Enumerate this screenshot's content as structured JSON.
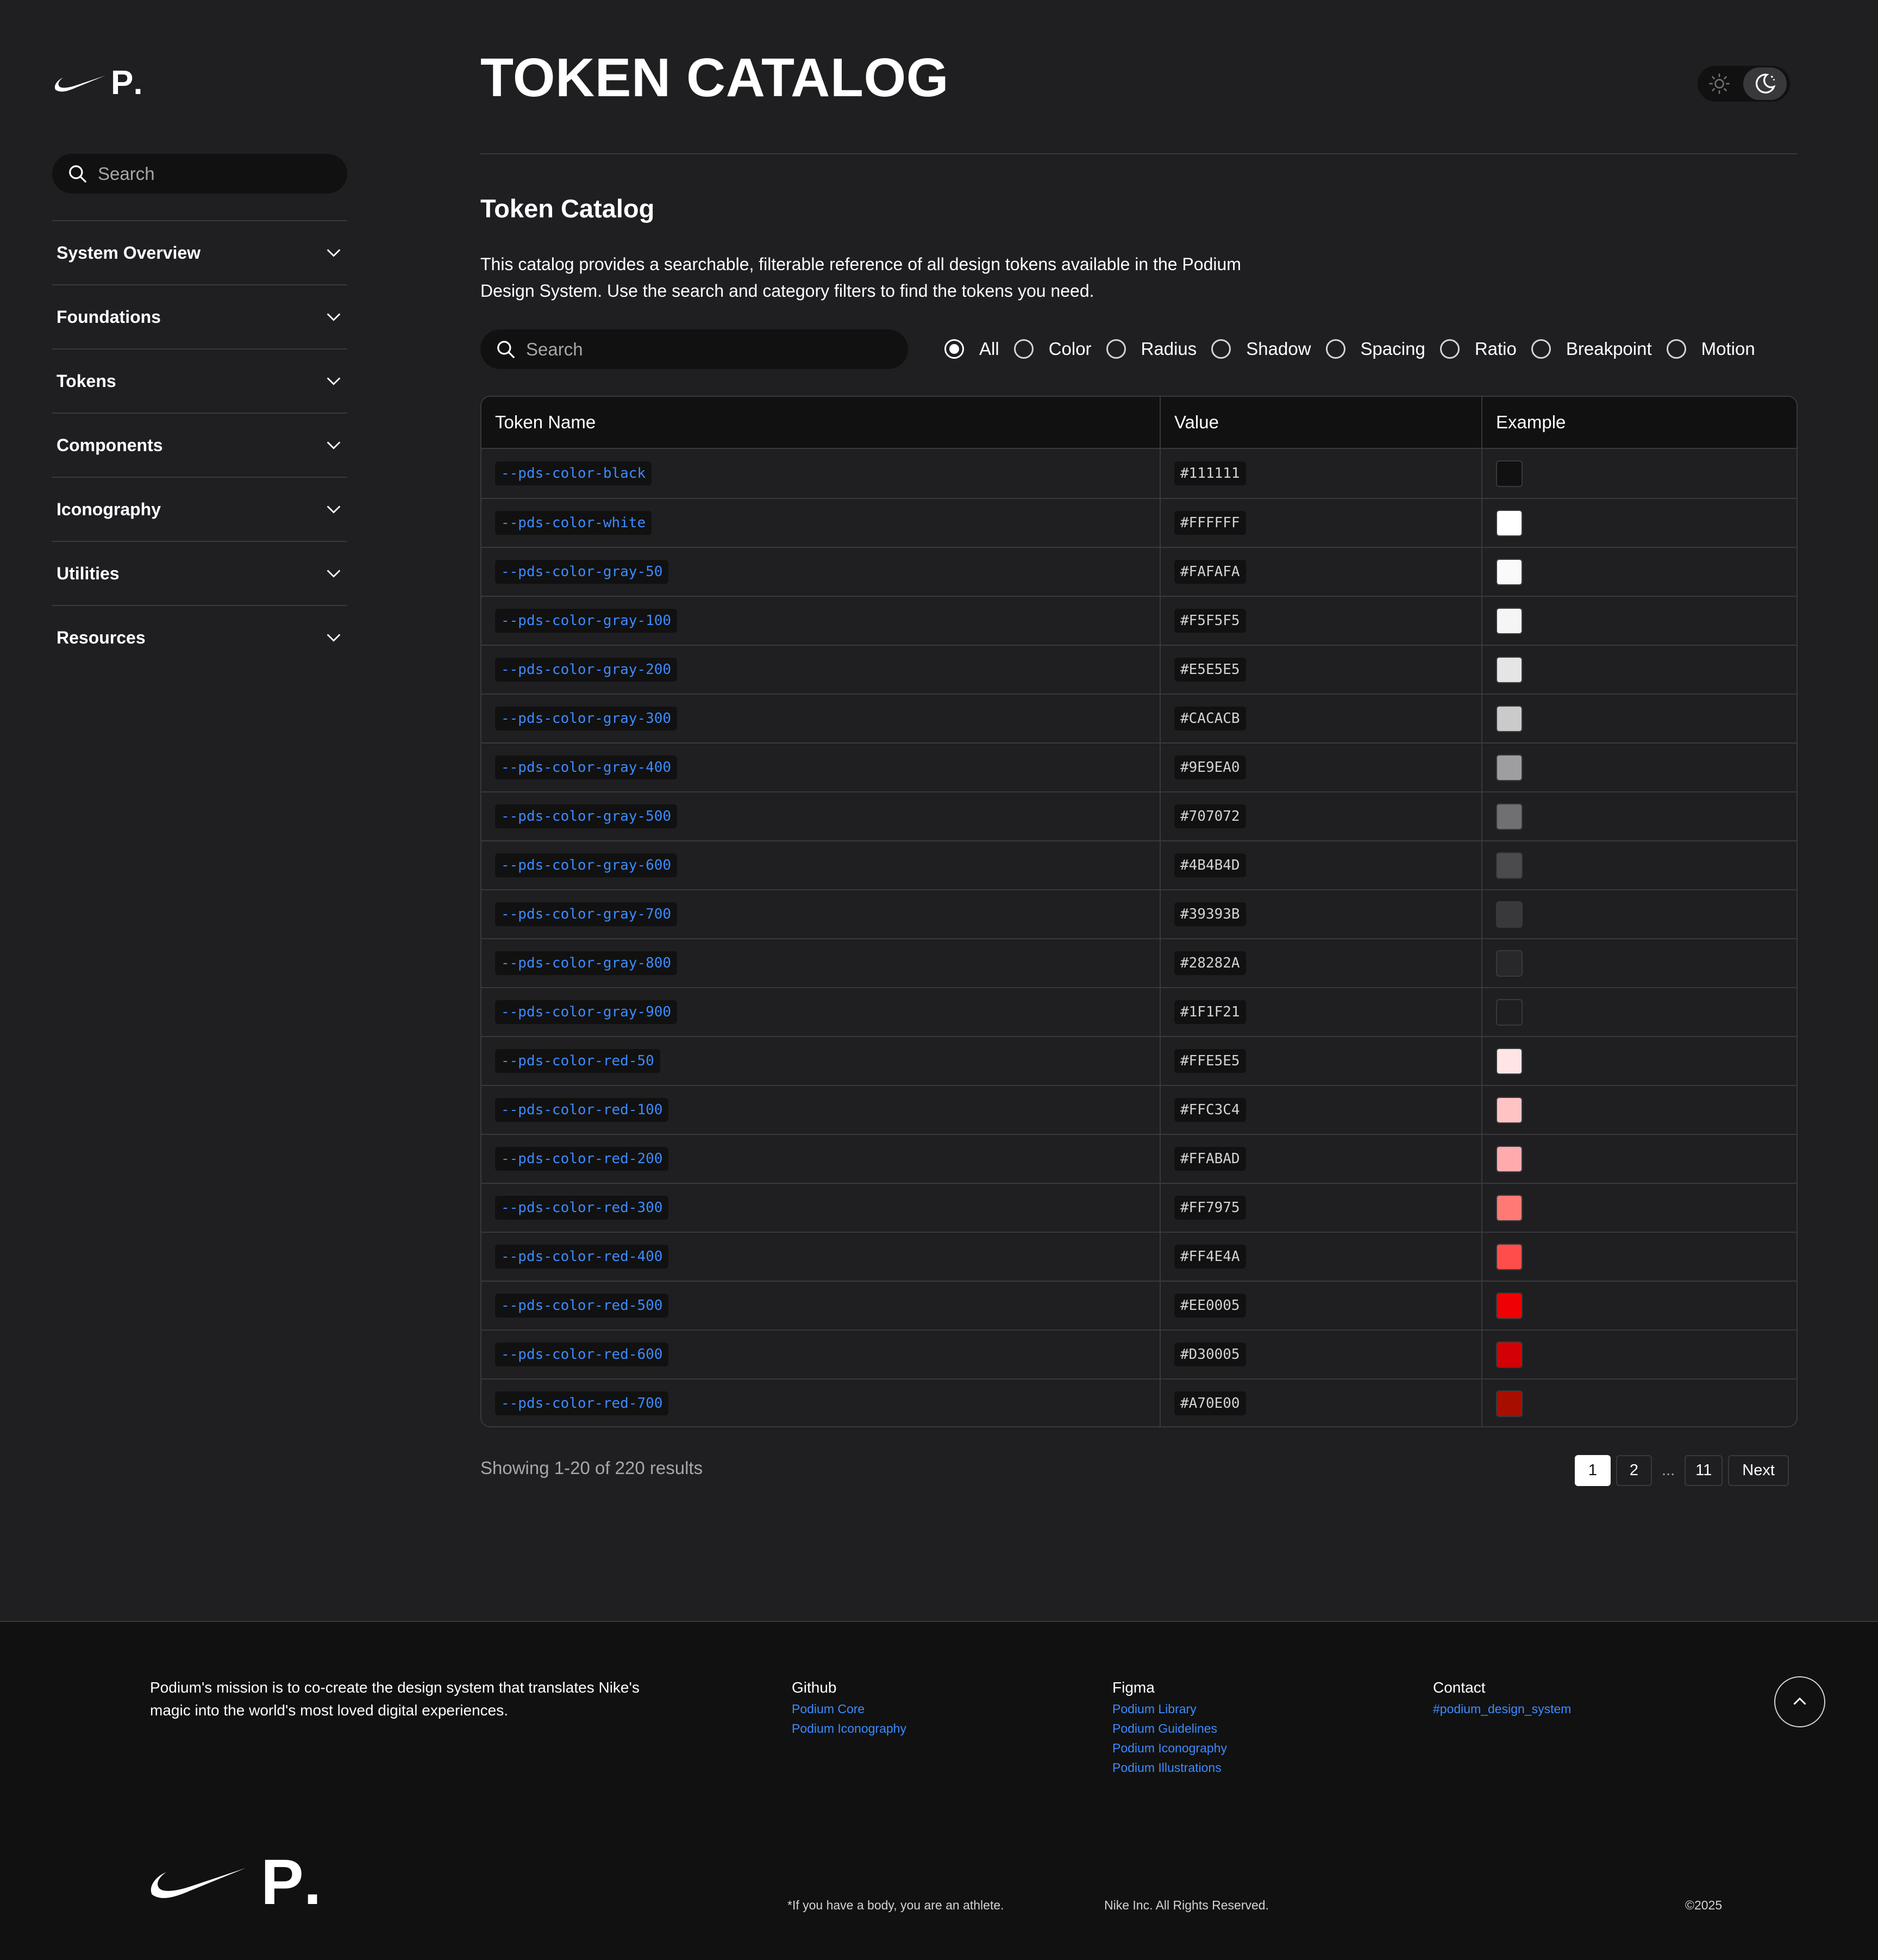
{
  "brand": {
    "logo_letter": "P",
    "logo_dot": "."
  },
  "sidebar": {
    "search_placeholder": "Search",
    "items": [
      {
        "label": "System Overview"
      },
      {
        "label": "Foundations"
      },
      {
        "label": "Tokens"
      },
      {
        "label": "Components"
      },
      {
        "label": "Iconography"
      },
      {
        "label": "Utilities"
      },
      {
        "label": "Resources"
      }
    ]
  },
  "header": {
    "title": "TOKEN CATALOG",
    "theme_toggle": {
      "options": [
        "light",
        "dark"
      ],
      "selected": "dark"
    }
  },
  "main": {
    "section_title": "Token Catalog",
    "intro": "This catalog provides a searchable, filterable reference of all design tokens available in the Podium Design System. Use the search and category filters to find the tokens you need.",
    "search_placeholder": "Search",
    "filters": [
      "All",
      "Color",
      "Radius",
      "Shadow",
      "Spacing",
      "Ratio",
      "Breakpoint",
      "Motion"
    ],
    "selected_filter": "All",
    "table": {
      "columns": [
        "Token Name",
        "Value",
        "Example"
      ],
      "rows": [
        {
          "name": "--pds-color-black",
          "value": "#111111"
        },
        {
          "name": "--pds-color-white",
          "value": "#FFFFFF"
        },
        {
          "name": "--pds-color-gray-50",
          "value": "#FAFAFA"
        },
        {
          "name": "--pds-color-gray-100",
          "value": "#F5F5F5"
        },
        {
          "name": "--pds-color-gray-200",
          "value": "#E5E5E5"
        },
        {
          "name": "--pds-color-gray-300",
          "value": "#CACACB"
        },
        {
          "name": "--pds-color-gray-400",
          "value": "#9E9EA0"
        },
        {
          "name": "--pds-color-gray-500",
          "value": "#707072"
        },
        {
          "name": "--pds-color-gray-600",
          "value": "#4B4B4D"
        },
        {
          "name": "--pds-color-gray-700",
          "value": "#39393B"
        },
        {
          "name": "--pds-color-gray-800",
          "value": "#28282A"
        },
        {
          "name": "--pds-color-gray-900",
          "value": "#1F1F21"
        },
        {
          "name": "--pds-color-red-50",
          "value": "#FFE5E5"
        },
        {
          "name": "--pds-color-red-100",
          "value": "#FFC3C4"
        },
        {
          "name": "--pds-color-red-200",
          "value": "#FFABAD"
        },
        {
          "name": "--pds-color-red-300",
          "value": "#FF7975"
        },
        {
          "name": "--pds-color-red-400",
          "value": "#FF4E4A"
        },
        {
          "name": "--pds-color-red-500",
          "value": "#EE0005"
        },
        {
          "name": "--pds-color-red-600",
          "value": "#D30005"
        },
        {
          "name": "--pds-color-red-700",
          "value": "#A70E00"
        }
      ]
    },
    "results_text": "Showing 1-20 of 220 results",
    "pagination": {
      "pages": [
        "1",
        "2"
      ],
      "ellipsis": "...",
      "last": "11",
      "next": "Next",
      "current": "1"
    }
  },
  "footer": {
    "mission": "Podium's mission is to co-create the design system that translates Nike's magic into the world's most loved digital experiences.",
    "github": {
      "heading": "Github",
      "links": [
        "Podium Core",
        "Podium Iconography"
      ]
    },
    "figma": {
      "heading": "Figma",
      "links": [
        "Podium Library",
        "Podium Guidelines",
        "Podium Iconography",
        "Podium Illustrations"
      ]
    },
    "contact": {
      "heading": "Contact",
      "links": [
        "#podium_design_system"
      ]
    },
    "tagline": "*If you have a body, you are an athlete.",
    "rights": "Nike Inc. All Rights Reserved.",
    "copyright": "©2025"
  },
  "colors": {
    "background": "#1F1F21",
    "surface": "#111111",
    "border": "#39393B",
    "link": "#3D8BFF",
    "text": "#FFFFFF",
    "muted": "#A7A7AA"
  },
  "icons": {
    "search": "search-icon",
    "chevron": "chevron-down-icon",
    "sun": "sun-icon",
    "moon": "moon-icon",
    "arrow_up": "arrow-up-icon",
    "logo": "swoosh-logo"
  }
}
